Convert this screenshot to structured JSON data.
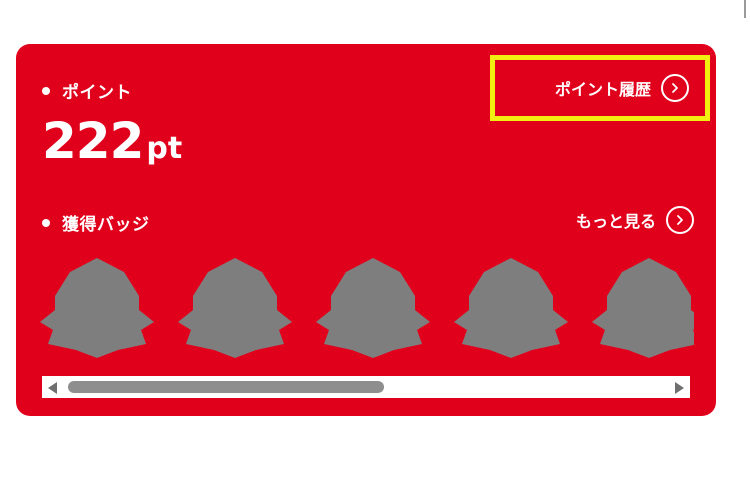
{
  "points": {
    "label": "ポイント",
    "value": "222",
    "unit": "pt",
    "history_link_label": "ポイント履歴"
  },
  "badges": {
    "label": "獲得バッジ",
    "more_link_label": "もっと見る",
    "items": [
      {
        "icon": "badge-placeholder-icon",
        "state": "locked"
      },
      {
        "icon": "badge-placeholder-icon",
        "state": "locked"
      },
      {
        "icon": "badge-placeholder-icon",
        "state": "locked"
      },
      {
        "icon": "badge-placeholder-icon",
        "state": "locked"
      },
      {
        "icon": "badge-placeholder-icon",
        "state": "locked"
      }
    ]
  },
  "scrollbar": {
    "thumb_fraction": 0.52,
    "scroll_position_fraction": 0.0
  },
  "colors": {
    "card_background": "#e1001b",
    "text": "#ffffff",
    "highlight_border": "#f2ee12",
    "badge_placeholder": "#7e7e7e",
    "scroll_thumb": "#8e8e8e"
  }
}
